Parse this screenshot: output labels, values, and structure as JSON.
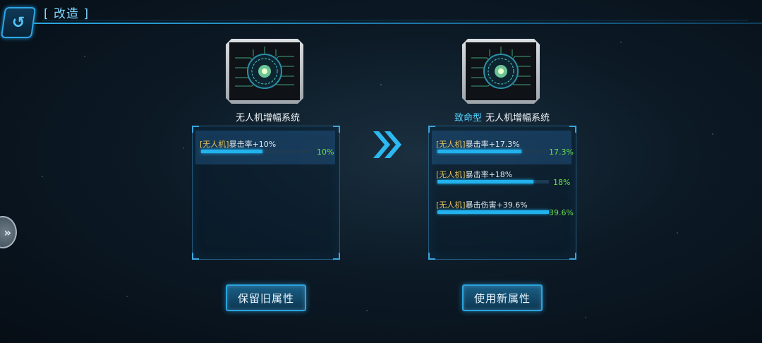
{
  "header": {
    "title": "[ 改造 ]",
    "back_icon": "back-arrow-icon"
  },
  "old_module": {
    "name": "无人机增幅系统"
  },
  "new_module": {
    "prefix": "致命型",
    "name": "无人机增幅系统"
  },
  "old_attributes": [
    {
      "tag": "[无人机]",
      "text": "暴击率+10%",
      "value": "10%",
      "fill": 0.55
    }
  ],
  "new_attributes": [
    {
      "tag": "[无人机]",
      "text": "暴击率+17.3%",
      "value": "17.3%",
      "fill": 0.75
    },
    {
      "tag": "[无人机]",
      "text": "暴击率+18%",
      "value": "18%",
      "fill": 0.86
    },
    {
      "tag": "[无人机]",
      "text": "暴击伤害+39.6%",
      "value": "39.6%",
      "fill": 1.0
    }
  ],
  "buttons": {
    "keep_old": "保留旧属性",
    "use_new": "使用新属性"
  },
  "colors": {
    "accent": "#22b2ee",
    "value_green": "#68e04c",
    "tag_yellow": "#e7c35c",
    "prefix_cyan": "#4fd2ff"
  }
}
